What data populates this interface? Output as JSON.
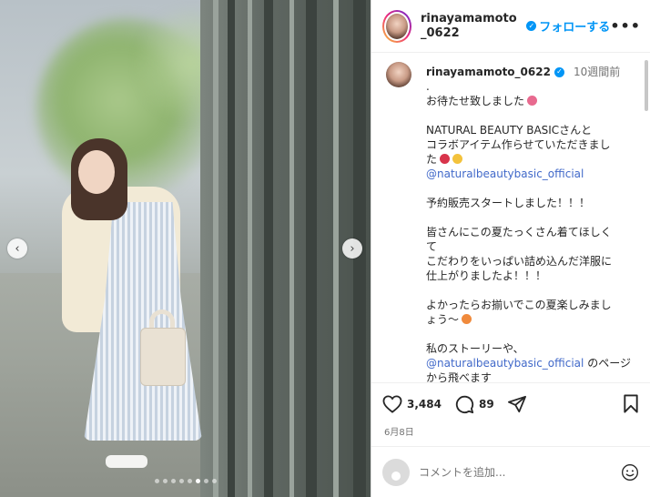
{
  "carousel": {
    "slide_count": 8,
    "active_index": 5,
    "prev_arrow": "‹",
    "next_arrow": "›"
  },
  "header": {
    "username": "rinayamamoto_0622",
    "follow_label": "フォローする",
    "more_label": "•••"
  },
  "caption": {
    "username": "rinayamamoto_0622",
    "time_ago": "10週間前",
    "lines": [
      ".",
      "お待たせ致しました",
      "",
      "NATURAL BEAUTY BASICさんと",
      "コラボアイテム作らせていただきまし",
      "た",
      "@naturalbeautybasic_official",
      "",
      "予約販売スタートしました！！！",
      "",
      "皆さんにこの夏たっくさん着てほしく",
      "て",
      "こだわりをいっぱい詰め込んだ洋服に",
      "仕上がりましたよ！！！",
      "",
      "よかったらお揃いでこの夏楽しみまし",
      "ょう〜",
      "",
      "私のストーリーや、",
      "@naturalbeautybasic_official",
      "のページ",
      "から飛べます"
    ]
  },
  "actions": {
    "likes": "3,484",
    "comments": "89"
  },
  "date": "6月8日",
  "comment_input": {
    "placeholder": "コメントを追加..."
  },
  "colors": {
    "accent": "#0095f6",
    "mention": "#4169c9",
    "muted": "#737373"
  },
  "icons": [
    "verified-badge-icon",
    "more-options-icon",
    "heart-icon",
    "comment-icon",
    "share-icon",
    "bookmark-icon",
    "emoji-smile-icon"
  ]
}
